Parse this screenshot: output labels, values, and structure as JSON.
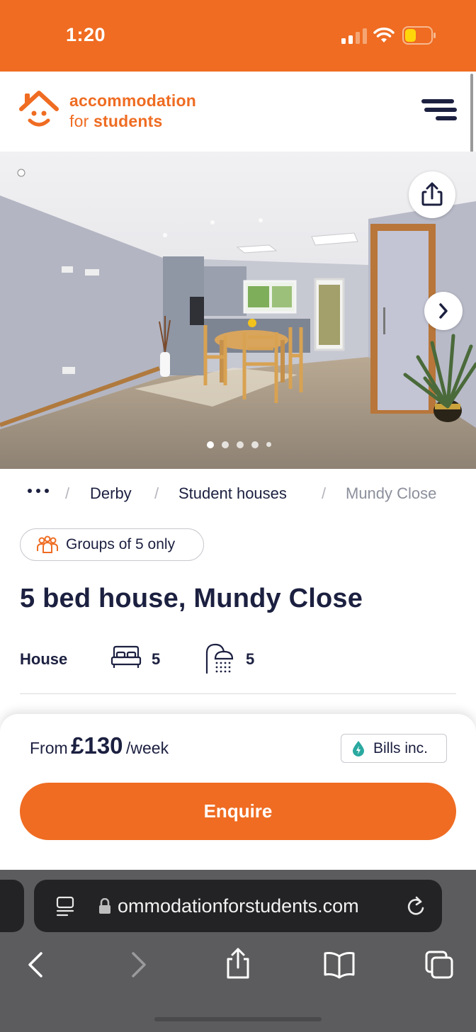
{
  "status_bar": {
    "time": "1:20"
  },
  "header": {
    "logo_line1": "accommodation",
    "logo_line2_prefix": "for ",
    "logo_line2_bold": "students",
    "brand_color": "#ef6c22"
  },
  "gallery": {
    "current_index": 1,
    "total_dots": 5
  },
  "breadcrumb": {
    "items": [
      "Derby",
      "Student houses",
      "Mundy Close"
    ]
  },
  "listing": {
    "tag": "Groups of 5 only",
    "title": "5 bed house, Mundy Close",
    "type": "House",
    "bedrooms": "5",
    "bathrooms": "5"
  },
  "pricing": {
    "from_label": "From",
    "amount": "£130",
    "unit": "/week",
    "bills_badge": "Bills inc.",
    "cta": "Enquire"
  },
  "browser": {
    "url": "ommodationforstudents.com"
  }
}
